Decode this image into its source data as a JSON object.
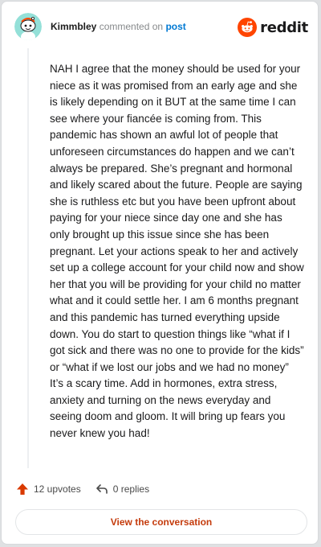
{
  "comment": {
    "author": "Kimmbley",
    "action_text": "commented on",
    "target_link": "post",
    "brand": "reddit",
    "body": "NAH I agree that the money should be used for your niece as it was promised from an early age and she is likely depending on it BUT at the same time I can see where your fiancée is coming from. This pandemic has shown an awful lot of people that unforeseen circumstances do happen and we can’t always be prepared. She’s pregnant and hormonal and likely scared about the future. People are saying she is ruthless etc but you have been upfront about paying for your niece since day one and she has only brought up this issue since she has been pregnant. Let your actions speak to her and actively set up a college account for your child now and show her that you will be providing for your child no matter what and it could settle her. I am 6 months pregnant and this pandemic has turned everything upside down. You do start to question things like “what if I got sick and there was no one to provide for the kids” or “what if we lost our jobs and we had no money” It’s a scary time. Add in hormones, extra stress, anxiety and turning on the news everyday and seeing doom and gloom. It will bring up fears you never knew you had!",
    "upvotes": "12 upvotes",
    "replies": "0 replies",
    "view_button": "View the conversation"
  },
  "colors": {
    "accent": "#d93a00",
    "link": "#0079d3",
    "reddit_orange": "#ff4500",
    "avatar_bg": "#94e0d8"
  },
  "icons": {
    "avatar": "snoo-avatar",
    "logo": "reddit-logo-icon",
    "upvote": "upvote-arrow-icon",
    "reply": "reply-arrow-icon"
  }
}
